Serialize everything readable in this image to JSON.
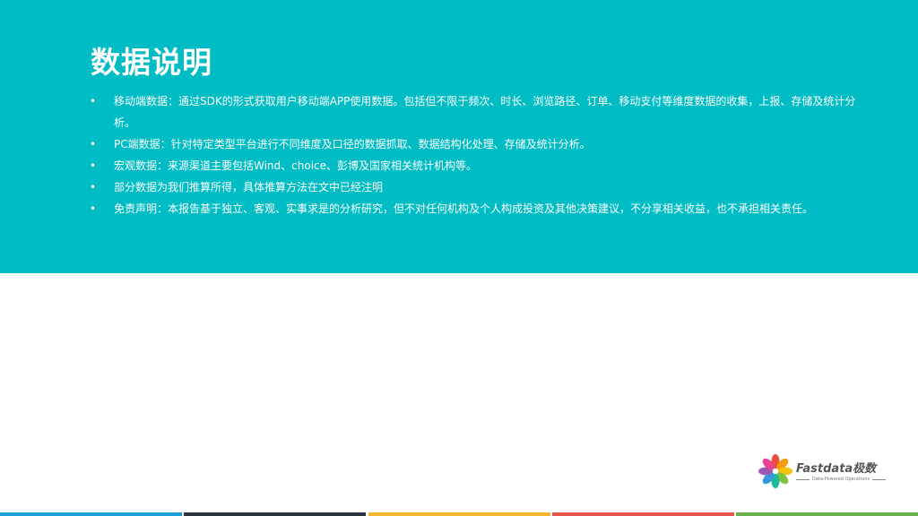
{
  "slide": {
    "title": "数据说明",
    "bullet_symbol": "•",
    "bullets": [
      "移动端数据：通过SDK的形式获取用户移动端APP使用数据。包括但不限于频次、时长、浏览路径、订单、移动支付等维度数据的收集，上报、存储及统计分析。",
      "PC端数据：针对特定类型平台进行不同维度及口径的数据抓取、数据结构化处理、存储及统计分析。",
      "宏观数据：来源渠道主要包括Wind、choice、彭博及国家相关统计机构等。",
      "部分数据为我们推算所得，具体推算方法在文中已经注明",
      "免责声明：本报告基于独立、客观、实事求是的分析研究，但不对任何机构及个人构成投资及其他决策建议，不分享相关收益，也不承担相关责任。"
    ]
  },
  "logo": {
    "name": "Fastdata极数",
    "tagline": "Data-Powered Operations",
    "icon": "flower-logo-icon"
  },
  "colors": {
    "banner": "#00bcc4",
    "text": "#ffffff",
    "footer": [
      "#1a9fd6",
      "#2d3440",
      "#f2b632",
      "#e8554e",
      "#6ab04c"
    ],
    "petals": [
      "#e84c3d",
      "#f39c12",
      "#f1c40f",
      "#7dc242",
      "#1abc9c",
      "#3498db",
      "#9b59b6",
      "#e84393"
    ]
  }
}
